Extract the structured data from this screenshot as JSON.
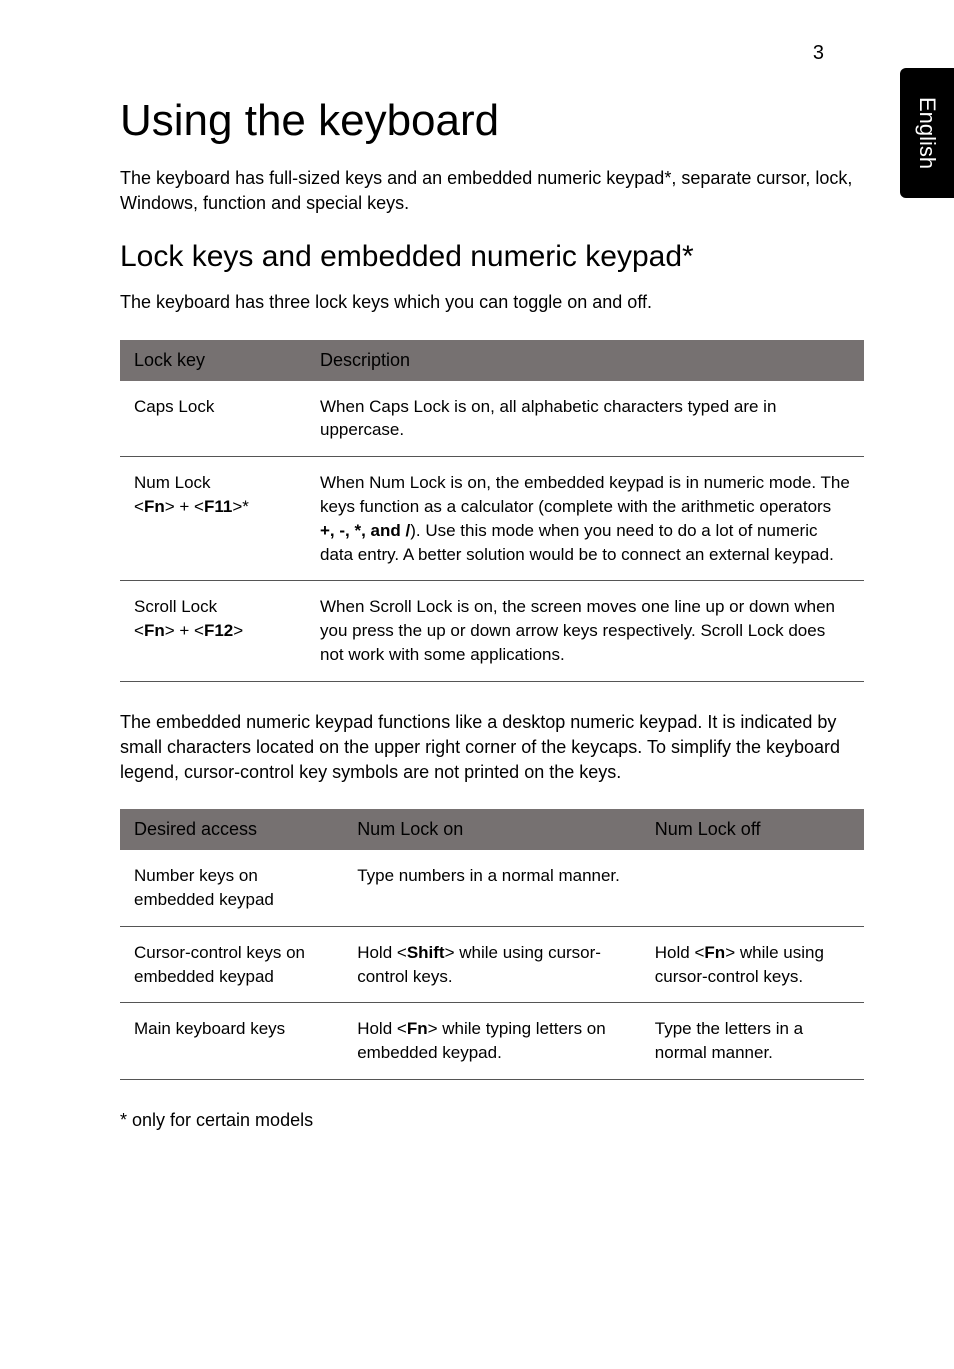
{
  "page_number": "3",
  "side_tab": "English",
  "heading": "Using the keyboard",
  "intro": "The keyboard has full-sized keys and an embedded numeric keypad*, separate cursor, lock, Windows, function and special keys.",
  "subheading": "Lock keys and embedded numeric keypad*",
  "subintro": "The keyboard has three lock keys which you can toggle on and off.",
  "table1": {
    "head": {
      "a": "Lock key",
      "b": "Description"
    },
    "rows": [
      {
        "a": "Caps Lock",
        "b": "When Caps Lock is on, all alphabetic characters typed are in uppercase."
      },
      {
        "a_line1": "Num Lock",
        "a_line2_pre": "<",
        "a_line2_fn": "Fn",
        "a_line2_mid": "> + <",
        "a_line2_f11": "F11",
        "a_line2_post": ">*",
        "b_pre": "When Num Lock is on, the embedded keypad is in numeric mode. The keys function as a calculator (complete with the arithmetic operators ",
        "b_ops": "+, -, *, and /",
        "b_post": "). Use this mode when you need to do a lot of numeric data entry. A better solution would be to connect an external keypad."
      },
      {
        "a_line1": "Scroll Lock",
        "a_line2_pre": "<",
        "a_line2_fn": "Fn",
        "a_line2_mid": "> + <",
        "a_line2_f12": "F12",
        "a_line2_post": ">",
        "b": "When Scroll Lock is on, the screen moves one line up or down when you press the up or down arrow keys respectively. Scroll Lock does not work with some applications."
      }
    ]
  },
  "midtext": "The embedded numeric keypad functions like a desktop numeric keypad. It is indicated by small characters located on the upper right corner of the keycaps. To simplify the keyboard legend, cursor-control key symbols are not printed on the keys.",
  "table2": {
    "head": {
      "a": "Desired access",
      "b": "Num Lock on",
      "c": "Num Lock off"
    },
    "rows": [
      {
        "a": "Number keys on embedded keypad",
        "b": "Type numbers in a normal manner.",
        "c": ""
      },
      {
        "a": "Cursor-control keys on embedded keypad",
        "b_pre": "Hold <",
        "b_key": "Shift",
        "b_post": "> while using cursor-control keys.",
        "c_pre": "Hold <",
        "c_key": "Fn",
        "c_post": "> while using cursor-control keys."
      },
      {
        "a": "Main keyboard keys",
        "b_pre": "Hold <",
        "b_key": "Fn",
        "b_post": "> while typing letters on embedded keypad.",
        "c": "Type the letters in a normal manner."
      }
    ]
  },
  "footnote": "* only for certain models"
}
